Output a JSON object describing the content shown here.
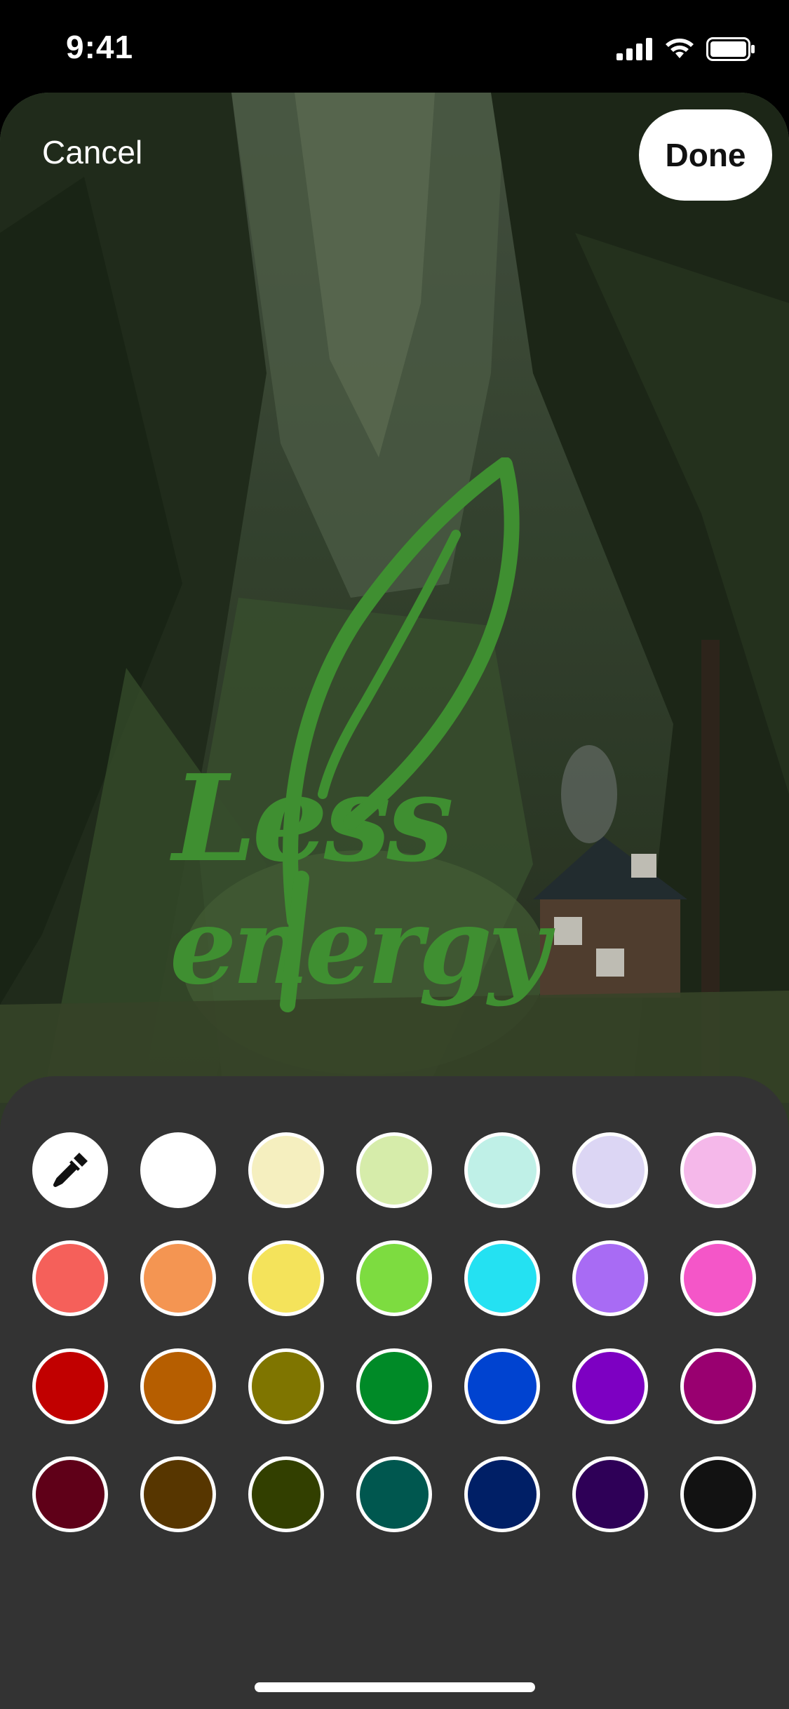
{
  "status_bar": {
    "time": "9:41"
  },
  "editor": {
    "cancel_label": "Cancel",
    "done_label": "Done",
    "sticker": {
      "line1": "Less",
      "line2": "energy",
      "color": "#3f8f31"
    }
  },
  "palette": {
    "eyedropper_icon": "eyedropper-icon",
    "colors": [
      "#ffffff",
      "#f5efbf",
      "#d6ecaa",
      "#bff0e7",
      "#dcd6f4",
      "#f5b8ea",
      "#f5605a",
      "#f49552",
      "#f4e35b",
      "#7ddc40",
      "#24e1f2",
      "#a86bf4",
      "#f456c8",
      "#c10000",
      "#b65e00",
      "#7f7500",
      "#008a27",
      "#0043d0",
      "#7d00c2",
      "#990070",
      "#5f0018",
      "#573600",
      "#323f00",
      "#00574f",
      "#001f66",
      "#2e0057",
      "#121212"
    ]
  }
}
